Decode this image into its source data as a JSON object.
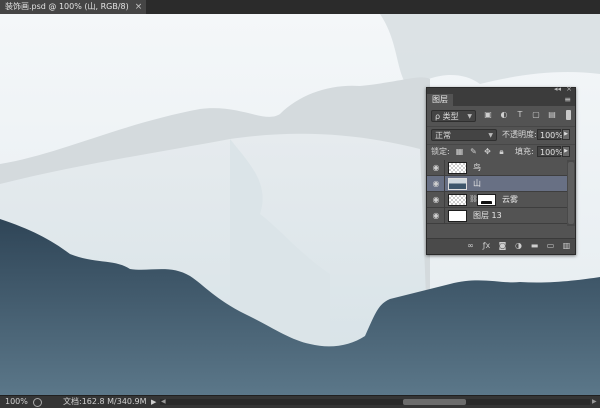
{
  "document_tab": {
    "title": "装饰画.psd @ 100% (山, RGB/8)",
    "close": "×"
  },
  "colors": {
    "sky": "#e9eff2",
    "mountain_dark": "#3e5567",
    "selected_layer": "#687084",
    "panel_bg": "#535353"
  },
  "status_bar": {
    "zoom": "100%",
    "doc_info": "文档:162.8 M/340.9M",
    "arrow": "▶"
  },
  "layers_panel": {
    "tab": "图层",
    "menu": "≡",
    "collapse": "◂◂",
    "close": "×",
    "filter": {
      "kind_label": "ρ 类型",
      "icons": [
        "image-filter-icon",
        "adjustment-filter-icon",
        "type-filter-icon",
        "shape-filter-icon",
        "smart-object-filter-icon"
      ]
    },
    "blend_mode": "正常",
    "opacity_label": "不透明度:",
    "opacity_value": "100%",
    "lock_label": "锁定:",
    "fill_label": "填充:",
    "fill_value": "100%",
    "layers": [
      {
        "name": "鸟",
        "selected": false,
        "thumb": "transparent"
      },
      {
        "name": "山",
        "selected": true,
        "thumb": "mountain"
      },
      {
        "name": "云雾",
        "selected": false,
        "thumb": "transparent",
        "mask": true
      },
      {
        "name": "图层 13",
        "selected": false,
        "thumb": "white"
      }
    ],
    "footer_icons": [
      "link-layers-icon",
      "fx-icon",
      "add-mask-icon",
      "new-adjustment-icon",
      "new-group-icon",
      "new-layer-icon",
      "delete-layer-icon"
    ]
  }
}
